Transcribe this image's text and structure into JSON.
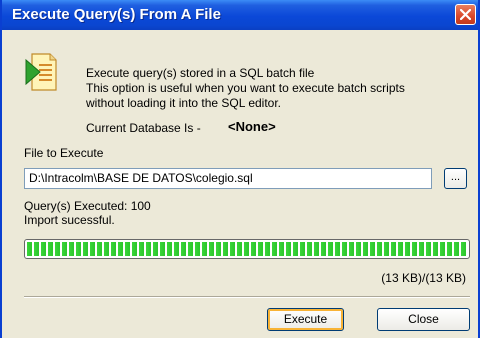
{
  "window": {
    "title": "Execute Query(s) From A File"
  },
  "description": {
    "line1": "Execute query(s) stored in a SQL batch file",
    "line2": "This option is useful when you want to execute batch scripts",
    "line3": "without loading it into the SQL editor."
  },
  "current_db": {
    "label": "Current Database Is -",
    "value": "<None>"
  },
  "file": {
    "label": "File to Execute",
    "value": "D:\\Intracolm\\BASE DE DATOS\\colegio.sql",
    "browse_label": "..."
  },
  "status": {
    "executed": "Query(s) Executed: 100",
    "message": "Import sucessful.",
    "progress_fraction": 1.0,
    "size_text": "(13 KB)/(13 KB)"
  },
  "buttons": {
    "execute": "Execute",
    "close": "Close"
  },
  "colors": {
    "titlebar": "#0a46d0",
    "progress": "#2cc52c",
    "dialog_bg": "#ece9d8"
  },
  "icons": {
    "title_close": "close-icon",
    "file": "sql-file-icon"
  }
}
